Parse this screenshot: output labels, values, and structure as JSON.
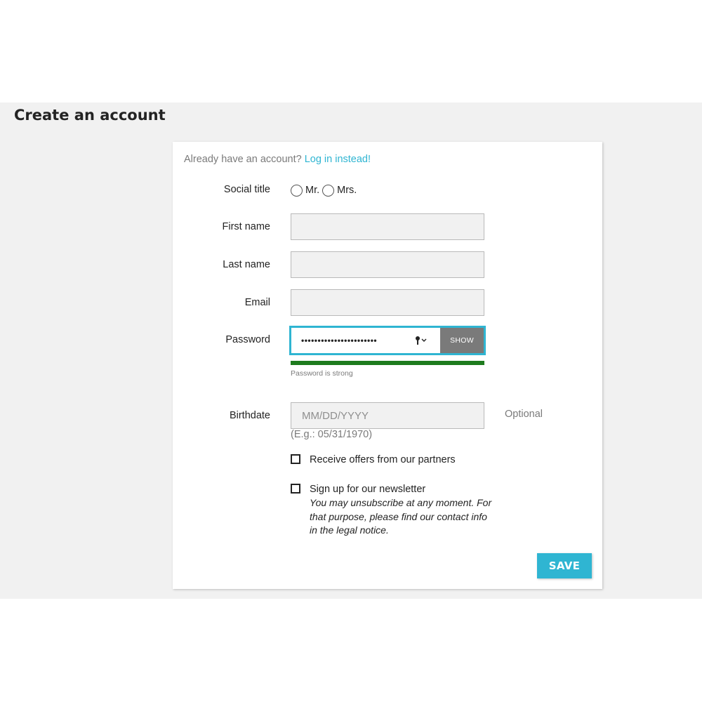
{
  "page": {
    "title": "Create an account"
  },
  "login_prompt": {
    "text": "Already have an account?",
    "link": "Log in instead!"
  },
  "form": {
    "social_title": {
      "label": "Social title",
      "options": [
        "Mr.",
        "Mrs."
      ]
    },
    "first_name": {
      "label": "First name",
      "value": ""
    },
    "last_name": {
      "label": "Last name",
      "value": ""
    },
    "email": {
      "label": "Email",
      "value": ""
    },
    "password": {
      "label": "Password",
      "masked_value": "•••••••••••••••••••••••",
      "show_label": "SHOW",
      "strength_text": "Password is strong",
      "strength_color": "#1e7b1e",
      "key_icon": "key-icon"
    },
    "birthdate": {
      "label": "Birthdate",
      "placeholder": "MM/DD/YYYY",
      "optional_text": "Optional",
      "example": "(E.g.: 05/31/1970)"
    },
    "partner_offers": {
      "label": "Receive offers from our partners",
      "checked": false
    },
    "newsletter": {
      "label": "Sign up for our newsletter",
      "note": "You may unsubscribe at any moment. For that purpose, please find our contact info in the legal notice.",
      "checked": false
    },
    "save_label": "SAVE"
  },
  "colors": {
    "accent": "#2fb5d2",
    "background_band": "#f1f1f1",
    "input_bg": "#f1f1f1",
    "show_button": "#7a7a7a"
  }
}
